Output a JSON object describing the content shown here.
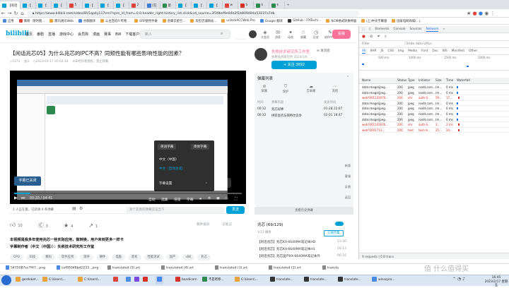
{
  "browser": {
    "tabs": [
      {
        "label": "【闲话"
      },
      {
        "label": "【"
      },
      {
        "label": "【"
      },
      {
        "label": "【"
      },
      {
        "label": "5"
      },
      {
        "label": "【"
      },
      {
        "label": "【"
      },
      {
        "label": "【"
      },
      {
        "label": "2"
      },
      {
        "label": "[在"
      },
      {
        "label": "第"
      },
      {
        "label": "【"
      },
      {
        "label": "【"
      },
      {
        "label": "【"
      },
      {
        "label": "w"
      },
      {
        "label": "S"
      },
      {
        "label": "k"
      },
      {
        "label": "k"
      }
    ],
    "url": "https://www.bilibili.com/video/BV1qa4y117em/?spm_id_from=0.0.header_right.history_list.click&vd_source=3f39bef9e84b2f1b809484a53237a7db",
    "bookmarks": [
      "应用",
      "微博 · 随时随...",
      "腾讯通讯Web",
      "谷歌翻译",
      "公主连结R 哔哩...",
      "ERP使用手册",
      "金蝶云星空...",
      "淘宝店铺网站...",
      "unlockACCWeb Pro",
      "Google 翻译",
      "GitHub - ITATech/...",
      "NCM格式转换神器",
      "(上)中文字幕版",
      "国家电网商城(...)"
    ]
  },
  "site": {
    "logo": "bilibili",
    "nav": [
      "首页",
      "番剧",
      "直播",
      "游戏中心",
      "会员购",
      "漫画",
      "赛事",
      "BW",
      "下载客户端"
    ],
    "search_placeholder": "新人",
    "header_icons": [
      "大会员",
      "消息",
      "动态",
      "收藏",
      "历史",
      "创作中心"
    ],
    "upload_label": "投稿"
  },
  "video": {
    "title": "【闲话兆芯05】为什么兆芯的IPC不高？同频性能有哪些影响性能的因素？",
    "views": "1373",
    "danmaku_count": "3",
    "date": "2023-01-17 05:02:14",
    "notice": "未经作者授权，禁止转载",
    "subtitle_badge": "字幕已关闭",
    "player_menu": {
      "items": [
        "英语字幕",
        "简体字幕",
        "中文（中国）",
        "中文（自动生成）",
        "字幕设置"
      ],
      "header": "英语字幕",
      "header_right": "简体字幕"
    },
    "time": "00:20 / 04:41",
    "controls": [
      "自动",
      "选集",
      "倍速",
      "字幕"
    ],
    "progress": 0.07,
    "danmaku_bar": {
      "watching": "1 人正在看，已装填 0 条弹幕",
      "placeholder": "发个友善的弹幕见证当下",
      "send": "发送"
    },
    "actions": [
      {
        "icon": "like-icon",
        "label": "10"
      },
      {
        "icon": "coin-icon",
        "label": "3"
      },
      {
        "icon": "star-icon",
        "label": "4"
      },
      {
        "icon": "share-icon",
        "label": "1"
      }
    ],
    "report": "稿件投诉",
    "note": "记笔记",
    "desc_line1": "本视频是我多年使用兆芯一些实际应用，做转换，用户来到更多一样卡",
    "desc_line2": "字幕制作者（中文（中国））：失秩技术研究所工作室",
    "tags": [
      "CPU",
      "科技",
      "数码",
      "软件应用",
      "测评",
      "硬件",
      "电脑",
      "装机",
      "性能测试",
      "国产",
      "x86",
      "兆芯"
    ]
  },
  "uploader": {
    "name": "失秩技术研究所工作室",
    "message": "发消息",
    "desc": "失秩技术研究所 2024/1/6",
    "follow": "+ 关注 3692"
  },
  "danmaku_panel": {
    "title": "弹幕列表",
    "tools": [
      "屏蔽",
      "保护",
      "云屏蔽",
      "其他"
    ],
    "columns": [
      "时间",
      "弹幕内容",
      "发送时间"
    ],
    "rows": [
      {
        "time": "00:12",
        "content": "兆芯好棒",
        "sent": "01-28 22:07"
      },
      {
        "time": "00:32",
        "content": "拼装会否与英特尔竞争",
        "sent": "02-01 18:47"
      }
    ],
    "list_button": "查看历史弹幕"
  },
  "collection": {
    "title": "兆芯 (69/129)",
    "subtitle": "1/12 播放",
    "subscribe": "订阅合集",
    "episodes": [
      {
        "label": "【闲话兆芯】兆芯KX-6640MA笔记本HD",
        "duration": "13:30"
      },
      {
        "label": "【闲话兆芯】兆芯KX-6640MA笔记本H3",
        "duration": "04:13"
      },
      {
        "label": "【闲话兆芯】兆芯国产KX-6640MA笔记本外",
        "duration": "06:16"
      },
      {
        "label": "【闲话兆芯】兆芯05",
        "duration": "04:41"
      }
    ]
  },
  "sidebar_buttons": [
    "新版",
    "客服",
    "反馈",
    "返回"
  ],
  "devtools": {
    "tabs": [
      "Elements",
      "Console",
      "Sources",
      "Network"
    ],
    "active_tab": "Network",
    "filter_placeholder": "Filter",
    "hide_data_urls": "Hide data URLs",
    "types": [
      "All",
      "XHR",
      "JS",
      "CSS",
      "Img",
      "Media",
      "Font",
      "Doc",
      "WS",
      "Manifest",
      "Other"
    ],
    "timeline_ticks": [
      "500 ms",
      "1000 ms",
      "1500 ms",
      "2000 ms"
    ],
    "columns": [
      "Name",
      "Status",
      "Type",
      "Initiator",
      "Size",
      "Time",
      "Waterfall"
    ],
    "rows": [
      {
        "name": "data:image/jpeg...",
        "status": "200",
        "type": "jpeg",
        "initiator": "nodd.com...",
        "size": "(m...",
        "time": "0 ms",
        "error": false
      },
      {
        "name": "data:image/jpeg...",
        "status": "200",
        "type": "jpeg",
        "initiator": "nodd.com...",
        "size": "(m...",
        "time": "0 ms",
        "error": false
      },
      {
        "name": "web?001141676...",
        "status": "200",
        "type": "xhr",
        "initiator": "auth-S...",
        "size": "59...",
        "time": "17...",
        "error": true
      },
      {
        "name": "data:image/jpeg...",
        "status": "200",
        "type": "jpeg",
        "initiator": "nodd.com...",
        "size": "(m...",
        "time": "0 ms",
        "error": false
      },
      {
        "name": "data:image/jpeg...",
        "status": "200",
        "type": "jpeg",
        "initiator": "nodd.com...",
        "size": "(m...",
        "time": "0 ms",
        "error": false
      },
      {
        "name": "data:image/jpeg...",
        "status": "200",
        "type": "jpeg",
        "initiator": "nodd.com...",
        "size": "(m...",
        "time": "0 ms",
        "error": false
      },
      {
        "name": "data:image/jpeg...",
        "status": "200",
        "type": "jpeg",
        "initiator": "nodd.com...",
        "size": "(m...",
        "time": "0 ms",
        "error": false
      },
      {
        "name": "web?001141676...",
        "status": "200",
        "type": "xhr",
        "initiator": "auth-S...",
        "size": "3...",
        "time": "2 ms",
        "error": true
      },
      {
        "name": "web?0001713...",
        "status": "200",
        "type": "text",
        "initiator": "text-m...",
        "size": "25...",
        "time": "24...",
        "error": true
      }
    ],
    "status_bar": "9 requests | 0 B trans"
  },
  "downloads": [
    "5475087cc7f47...png",
    "cef95048bd2233...png",
    "translated (5).srt",
    "translated (4).srt",
    "translated (3).srt",
    "translated (2).srt",
    "transla"
  ],
  "taskbar": {
    "items": [
      "gerdoket...",
      "C:\\Users\\...",
      "C:\\Users\\...",
      "",
      "bandicam",
      "不是吧移...",
      "C:\\Users\\...",
      "translate...",
      "translate...",
      "translate...",
      "winscpro..."
    ],
    "time": "16:45",
    "date": "2023/2/17 星期五"
  },
  "watermark": "值 什么值得买",
  "colors": {
    "bili_blue": "#00a1d6",
    "bili_pink": "#fb7299",
    "error_red": "#d93025"
  }
}
